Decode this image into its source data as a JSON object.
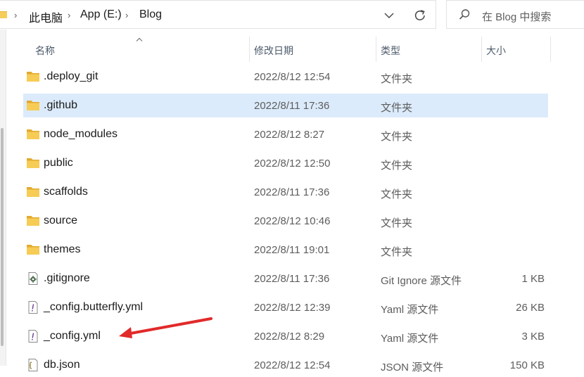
{
  "breadcrumb": {
    "items": [
      "此电脑",
      "App (E:)",
      "Blog"
    ],
    "separator": "›"
  },
  "search": {
    "placeholder": "在 Blog 中搜索"
  },
  "columns": {
    "name": "名称",
    "date": "修改日期",
    "type": "类型",
    "size": "大小"
  },
  "rows": [
    {
      "icon": "folder-icon",
      "name": ".deploy_git",
      "date": "2022/8/12 12:54",
      "type": "文件夹",
      "size": ""
    },
    {
      "icon": "folder-icon",
      "name": ".github",
      "date": "2022/8/11 17:36",
      "type": "文件夹",
      "size": "",
      "selected": true
    },
    {
      "icon": "folder-icon",
      "name": "node_modules",
      "date": "2022/8/12 8:27",
      "type": "文件夹",
      "size": ""
    },
    {
      "icon": "folder-icon",
      "name": "public",
      "date": "2022/8/12 12:50",
      "type": "文件夹",
      "size": ""
    },
    {
      "icon": "folder-icon",
      "name": "scaffolds",
      "date": "2022/8/11 17:36",
      "type": "文件夹",
      "size": ""
    },
    {
      "icon": "folder-icon",
      "name": "source",
      "date": "2022/8/12 10:46",
      "type": "文件夹",
      "size": ""
    },
    {
      "icon": "folder-icon",
      "name": "themes",
      "date": "2022/8/11 19:01",
      "type": "文件夹",
      "size": ""
    },
    {
      "icon": "gear-file-icon",
      "name": ".gitignore",
      "date": "2022/8/11 17:36",
      "type": "Git Ignore 源文件",
      "size": "1 KB"
    },
    {
      "icon": "yaml-file-icon",
      "name": "_config.butterfly.yml",
      "date": "2022/8/12 12:39",
      "type": "Yaml 源文件",
      "size": "26 KB"
    },
    {
      "icon": "yaml-file-icon",
      "name": "_config.yml",
      "date": "2022/8/12 8:29",
      "type": "Yaml 源文件",
      "size": "3 KB"
    },
    {
      "icon": "json-file-icon",
      "name": "db.json",
      "date": "2022/8/12 12:54",
      "type": "JSON 源文件",
      "size": "150 KB"
    }
  ],
  "colors": {
    "selection": "#dcebfb",
    "folder": "#f0c24a",
    "annotation_arrow": "#e12a2a"
  }
}
